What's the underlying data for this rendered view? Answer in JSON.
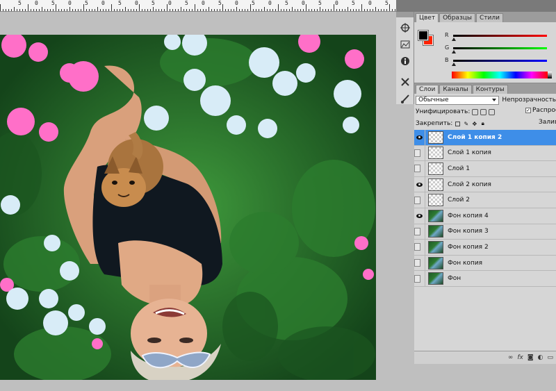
{
  "ruler": {
    "labels": [
      "5",
      "0",
      "5",
      "0",
      "5",
      "0",
      "5",
      "0",
      "5",
      "0",
      "5",
      "0",
      "5",
      "0",
      "5",
      "0",
      "5",
      "0",
      "5",
      "0",
      "5",
      "0",
      "5",
      "0"
    ]
  },
  "color_panel": {
    "tabs": [
      "Цвет",
      "Образцы",
      "Стили"
    ],
    "active_tab": "Цвет",
    "foreground": "#000000",
    "background": "#ff2200",
    "channels": [
      {
        "label": "R",
        "gradient": "linear-gradient(to right,#000,#ff0000)"
      },
      {
        "label": "G",
        "gradient": "linear-gradient(to right,#000,#00ff00)"
      },
      {
        "label": "B",
        "gradient": "linear-gradient(to right,#000,#0000ff)"
      }
    ]
  },
  "layers_panel": {
    "tabs": [
      "Слои",
      "Каналы",
      "Контуры"
    ],
    "active_tab": "Слои",
    "blend_mode": "Обычные",
    "opacity_label": "Непрозрачность",
    "unify_label": "Унифицировать:",
    "spread_label": "Распрост",
    "lock_label": "Закрепить:",
    "fill_label": "Залив",
    "layers": [
      {
        "name": "Слой 1 копия 2",
        "visible": true,
        "selected": true,
        "thumb": "transparent"
      },
      {
        "name": "Слой 1 копия",
        "visible": false,
        "selected": false,
        "thumb": "transparent"
      },
      {
        "name": "Слой 1",
        "visible": false,
        "selected": false,
        "thumb": "transparent"
      },
      {
        "name": "Слой 2 копия",
        "visible": true,
        "selected": false,
        "thumb": "transparent"
      },
      {
        "name": "Слой 2",
        "visible": false,
        "selected": false,
        "thumb": "transparent"
      },
      {
        "name": "Фон копия 4",
        "visible": true,
        "selected": false,
        "thumb": "photo"
      },
      {
        "name": "Фон копия 3",
        "visible": false,
        "selected": false,
        "thumb": "photo"
      },
      {
        "name": "Фон копия 2",
        "visible": false,
        "selected": false,
        "thumb": "photo"
      },
      {
        "name": "Фон копия",
        "visible": false,
        "selected": false,
        "thumb": "photo"
      },
      {
        "name": "Фон",
        "visible": false,
        "selected": false,
        "thumb": "photo"
      }
    ],
    "bottom_icons": [
      "link-icon",
      "fx-icon",
      "mask-icon",
      "adjustment-icon",
      "folder-icon"
    ]
  },
  "mini_tools": [
    "navigator-icon",
    "histogram-icon",
    "info-icon",
    "tools-icon",
    "brush-icon"
  ]
}
